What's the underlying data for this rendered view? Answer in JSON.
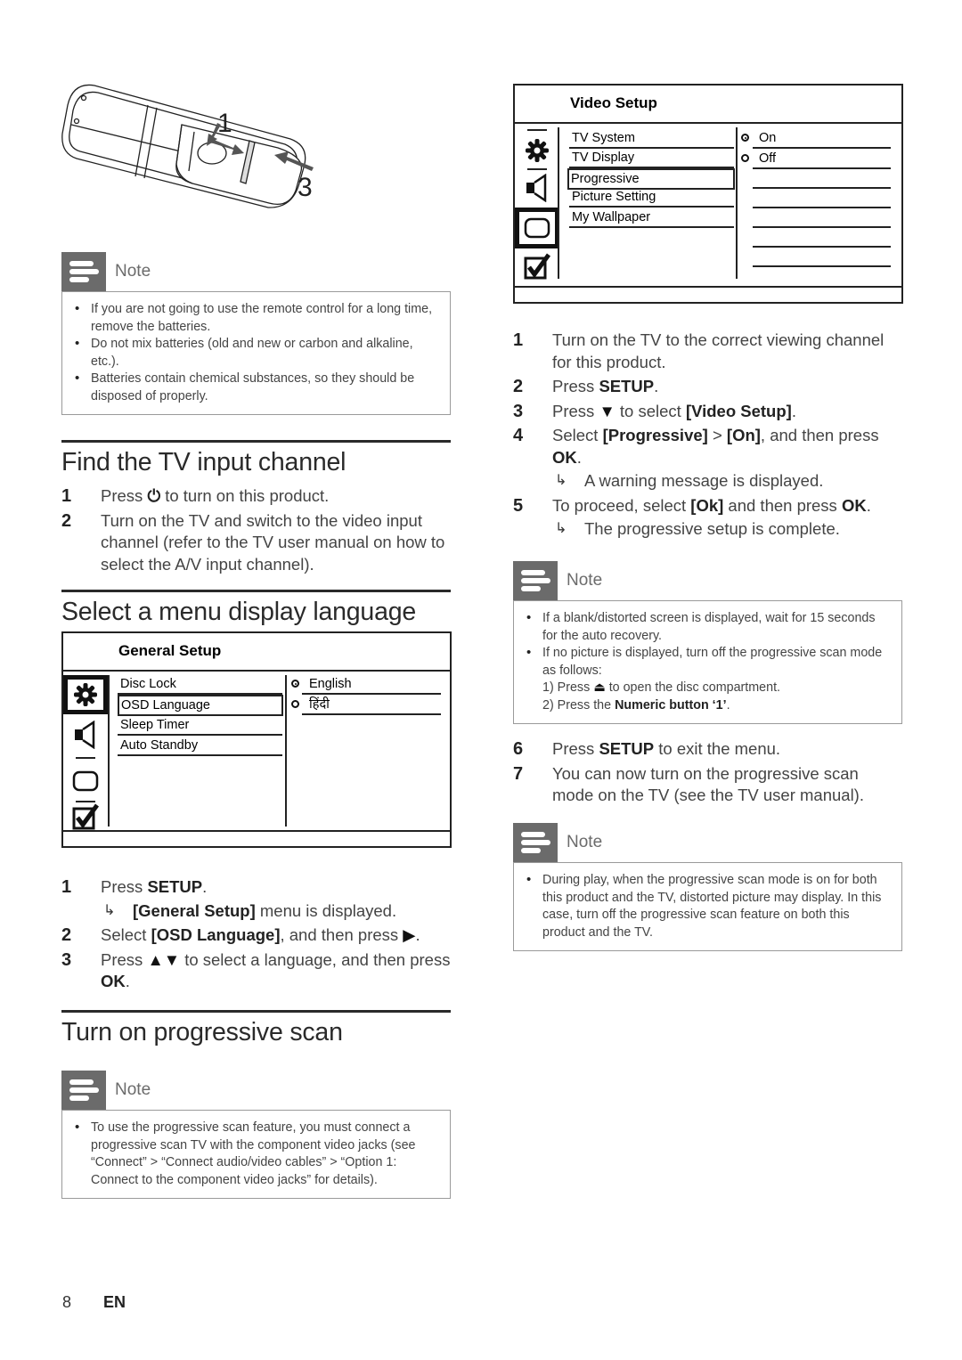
{
  "page": {
    "page_number": "8",
    "language_code": "EN"
  },
  "illustration": {
    "label_1": "1",
    "label_3": "3"
  },
  "note_batteries": {
    "title": "Note",
    "items": [
      "If you are not going to use the remote control for a long time, remove the batteries.",
      "Do not mix batteries (old and new or carbon and alkaline, etc.).",
      "Batteries contain chemical substances, so they should be disposed of properly."
    ]
  },
  "find_tv_channel": {
    "heading": "Find the TV input channel",
    "steps": [
      {
        "num": "1",
        "pre": "Press ",
        "icon": "power-icon",
        "post": " to turn on this product."
      },
      {
        "num": "2",
        "text": "Turn on the TV and switch to the video input channel (refer to the TV user manual on how to select the A/V input channel)."
      }
    ]
  },
  "menu_language": {
    "heading": "Select a menu display language",
    "osd": {
      "title": "General Setup",
      "items": [
        "Disc Lock",
        "OSD Language",
        "Sleep Timer",
        "Auto Standby"
      ],
      "selected_item": "OSD Language",
      "options": [
        {
          "label": "English",
          "selected": true
        },
        {
          "label": "हिंदी",
          "selected": false
        }
      ],
      "active_tab": "general-setup"
    },
    "steps": [
      {
        "num": "1",
        "pre": "Press ",
        "bold": "SETUP",
        "post": ".",
        "result_bold": "[General Setup]",
        "result_post": " menu is displayed."
      },
      {
        "num": "2",
        "pre": "Select ",
        "bold": "[OSD Language]",
        "post": ", and then press ",
        "symbol": "▶",
        "tail": "."
      },
      {
        "num": "3",
        "pre": "Press ",
        "symbol": "▲▼",
        "post": " to select a language, and then press ",
        "bold": "OK",
        "tail": "."
      }
    ]
  },
  "progressive_scan": {
    "heading": "Turn on progressive scan",
    "note": {
      "title": "Note",
      "items": [
        "To use the progressive scan feature, you must connect a progressive scan TV with the component video jacks (see “Connect” > “Connect audio/video cables” > “Option 1: Connect to the component video jacks” for details)."
      ]
    },
    "osd": {
      "title": "Video Setup",
      "items": [
        "TV System",
        "TV Display",
        "Progressive",
        "Picture Setting",
        "My Wallpaper"
      ],
      "selected_item": "Progressive",
      "options": [
        {
          "label": "On",
          "selected": true
        },
        {
          "label": "Off",
          "selected": false
        }
      ],
      "active_tab": "video-setup"
    },
    "steps": [
      {
        "num": "1",
        "text": "Turn on the TV to the correct viewing channel for this product."
      },
      {
        "num": "2",
        "pre": "Press ",
        "bold": "SETUP",
        "post": "."
      },
      {
        "num": "3",
        "pre": "Press ",
        "symbol": "▼",
        "post": " to select ",
        "bold": "[Video Setup]",
        "tail": "."
      },
      {
        "num": "4",
        "pre": "Select ",
        "bold": "[Progressive]",
        "mid": " > ",
        "bold2": "[On]",
        "post": ", and then press ",
        "bold3": "OK",
        "tail": ".",
        "result": "A warning message is displayed."
      },
      {
        "num": "5",
        "pre": "To proceed, select ",
        "bold": "[Ok]",
        "post": " and then press ",
        "bold2": "OK",
        "tail": ".",
        "result": "The progressive setup is complete."
      },
      {
        "num": "6",
        "pre": "Press ",
        "bold": "SETUP",
        "post": " to exit the menu."
      },
      {
        "num": "7",
        "text": "You can now turn on the progressive scan mode on the TV (see the TV user manual)."
      }
    ],
    "note_recovery": {
      "title": "Note",
      "item1": "If a blank/distorted screen is displayed, wait for 15 seconds for the auto recovery.",
      "item2": "If no picture is displayed, turn off the progressive scan mode as follows:",
      "sub1_pre": "1) Press ",
      "sub1_symbol": "⏏",
      "sub1_post": " to open the disc compartment.",
      "sub2_pre": "2) Press the ",
      "sub2_bold": "Numeric button ‘1’",
      "sub2_post": "."
    },
    "note_distorted": {
      "title": "Note",
      "items": [
        "During play, when the progressive scan mode is on for both this product and the TV, distorted picture may display. In this case, turn off the progressive scan feature on both this product and the TV."
      ]
    }
  }
}
